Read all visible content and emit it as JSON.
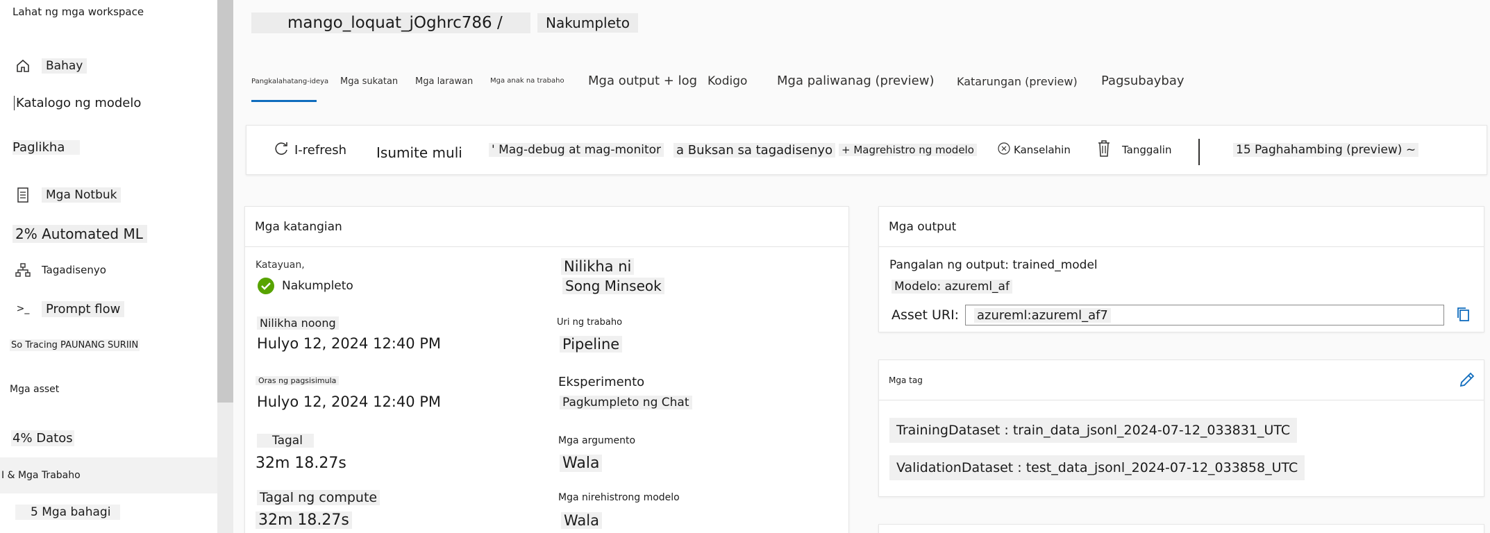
{
  "sidebar": {
    "workspace_label": "Lahat ng mga workspace",
    "items": [
      {
        "label": "Bahay",
        "icon": "home-icon"
      },
      {
        "label": "Katalogo ng modelo",
        "icon": ""
      },
      {
        "label": "Paglikha",
        "icon": ""
      },
      {
        "label": "Mga Notbuk",
        "icon": "notebook-icon"
      },
      {
        "label": "2% Automated ML",
        "icon": ""
      },
      {
        "label": "Tagadisenyo",
        "icon": "designer-icon"
      },
      {
        "label": "Prompt flow",
        "icon": "prompt-flow-icon"
      },
      {
        "label": "So Tracing PAUNANG SURIIN",
        "icon": ""
      },
      {
        "label": "Mga asset",
        "icon": ""
      },
      {
        "label": "4% Datos",
        "icon": ""
      },
      {
        "label": "I & Mga Trabaho",
        "icon": ""
      },
      {
        "label": "5 Mga bahagi",
        "icon": ""
      }
    ]
  },
  "header": {
    "title": "mango_loquat_jOghrc786 /",
    "status": "Nakumpleto"
  },
  "tabs": [
    "Pangkalahatang-ideya",
    "Mga sukatan",
    "Mga larawan",
    "Mga anak na trabaho",
    "Mga output + log",
    "Kodigo",
    "Mga paliwanag (preview)",
    "Katarungan (preview)",
    "Pagsubaybay"
  ],
  "toolbar": {
    "refresh": "I-refresh",
    "resubmit": "Isumite muli",
    "debug": "' Mag-debug at mag-monitor",
    "open_designer": "a Buksan sa tagadisenyo",
    "register_model": "+ Magrehistro ng modelo",
    "cancel": "Kanselahin",
    "delete": "Tanggalin",
    "compare": "15 Paghahambing (preview) ~"
  },
  "properties": {
    "heading": "Mga katangian",
    "status_label": "Katayuan,",
    "status_value": "Nakumpleto",
    "created_by_label": "Nilikha ni",
    "created_by_value": "Song Minseok",
    "created_on_label": "Nilikha noong",
    "created_on_value": "Hulyo 12, 2024 12:40 PM",
    "job_type_label": "Uri ng trabaho",
    "job_type_value": "Pipeline",
    "start_time_label": "Oras ng pagsisimula",
    "start_time_value": "Hulyo 12, 2024 12:40 PM",
    "experiment_label": "Eksperimento",
    "experiment_value": "Pagkumpleto ng Chat",
    "duration_label": "Tagal",
    "duration_value": "32m 18.27s",
    "arguments_label": "Mga argumento",
    "arguments_value": "Wala",
    "compute_duration_label": "Tagal ng compute",
    "compute_duration_value": "32m 18.27s",
    "registered_models_label": "Mga nirehistrong modelo",
    "registered_models_value": "Wala"
  },
  "outputs": {
    "heading": "Mga output",
    "output_name": "Pangalan ng output: trained_model",
    "model": "Modelo: azureml_af",
    "asset_uri_label": "Asset URI:",
    "asset_uri_value": "azureml:azureml_af7"
  },
  "tags": {
    "heading": "Mga tag",
    "items": [
      "TrainingDataset : train_data_jsonl_2024-07-12_033831_UTC",
      "ValidationDataset : test_data_jsonl_2024-07-12_033858_UTC"
    ]
  },
  "colors": {
    "accent": "#0f6cbd",
    "success": "#57a300"
  }
}
